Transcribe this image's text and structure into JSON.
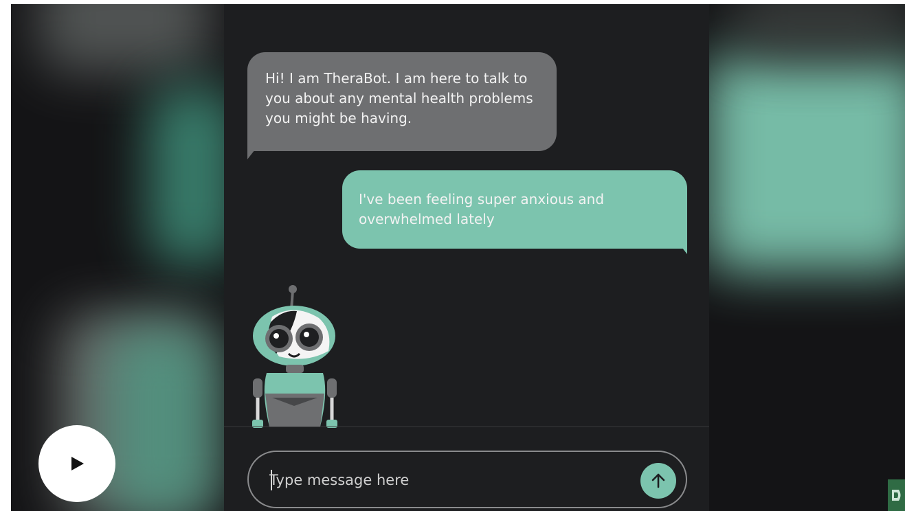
{
  "chat": {
    "bot_message": "Hi! I am TheraBot. I am here to talk to you about any mental health problems you might be having.",
    "user_message": "I've been feeling super anxious and overwhelmed lately"
  },
  "composer": {
    "placeholder": "Type message here",
    "value": ""
  },
  "icons": {
    "send": "arrow-up-icon",
    "play": "play-icon",
    "robot": "therabot-robot-illustration",
    "corner_logo": "leaf-logo-icon"
  },
  "colors": {
    "accent": "#7cc4ae",
    "bot_bubble": "#6e6f71",
    "background": "#1d1e20"
  }
}
